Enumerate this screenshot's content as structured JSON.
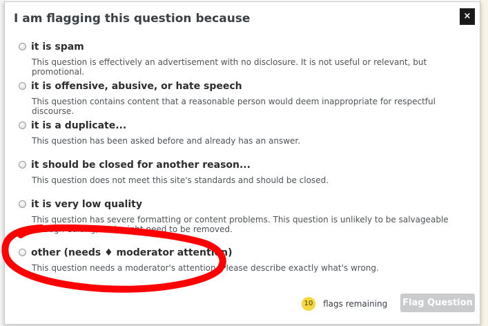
{
  "dialog": {
    "title": "I am flagging this question because",
    "close_label": "×"
  },
  "options": [
    {
      "label": "it is spam",
      "description": "This question is effectively an advertisement with no disclosure. It is not useful or relevant, but promotional."
    },
    {
      "label": "it is offensive, abusive, or hate speech",
      "description": "This question contains content that a reasonable person would deem inappropriate for respectful discourse."
    },
    {
      "label": "it is a duplicate...",
      "description": "This question has been asked before and already has an answer."
    },
    {
      "label": "it should be closed for another reason...",
      "description": "This question does not meet this site's standards and should be closed."
    },
    {
      "label": "it is very low quality",
      "description": "This question has severe formatting or content problems. This question is unlikely to be salvageable through editing, and might need to be removed."
    },
    {
      "label": "other (needs ♦ moderator attention)",
      "description": "This question needs a moderator's attention. Please describe exactly what's wrong."
    }
  ],
  "footer": {
    "flags_count": "10",
    "flags_text": "flags remaining",
    "submit_label": "Flag Question"
  },
  "colors": {
    "annotation": "#ff0000",
    "badge": "#f5d63d",
    "disabled_button": "#c9cbcd"
  }
}
